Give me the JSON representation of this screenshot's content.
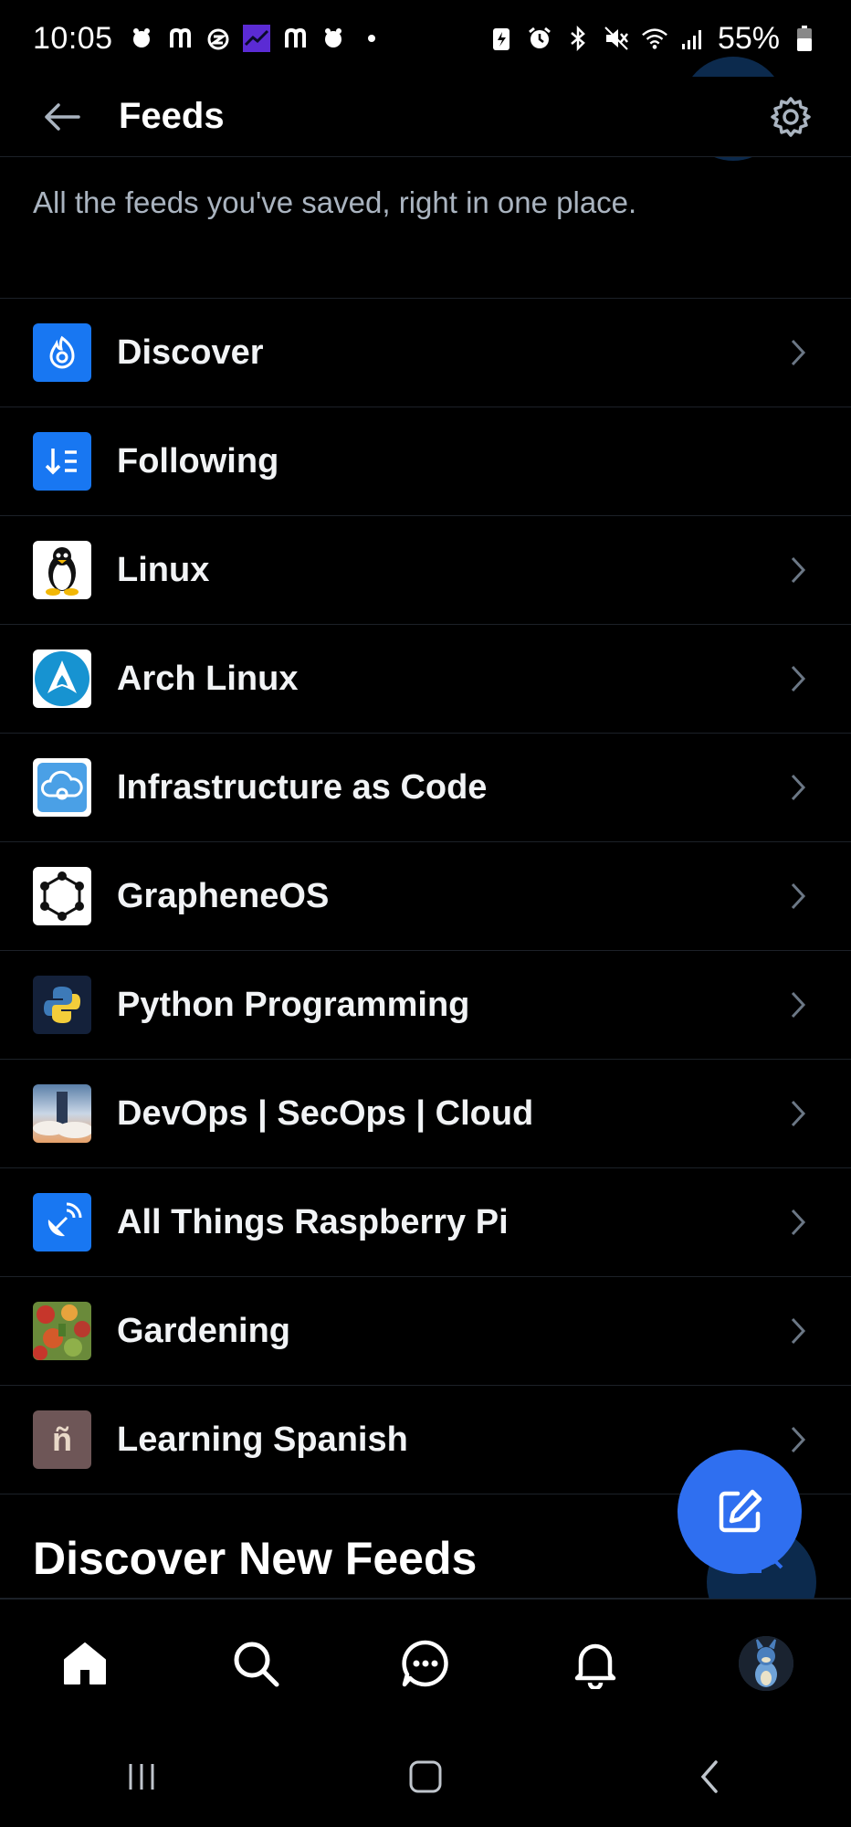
{
  "status_bar": {
    "time": "10:05",
    "battery": "55%",
    "left_icons": [
      "notification-icon",
      "n-app-icon",
      "dnd-icon",
      "stocks-app-icon",
      "n-app-icon",
      "notification-icon",
      "dot-icon"
    ],
    "right_icons": [
      "battery-saver-icon",
      "alarm-icon",
      "bluetooth-icon",
      "mute-icon",
      "wifi-icon",
      "signal-icon",
      "battery-icon"
    ]
  },
  "header": {
    "title": "Feeds",
    "back_icon": "arrow-left-icon",
    "settings_icon": "gear-icon"
  },
  "intro": {
    "description": "All the feeds you've saved, right in one place."
  },
  "feeds": [
    {
      "label": "Discover",
      "icon": "discover-feed-icon",
      "chevron": true
    },
    {
      "label": "Following",
      "icon": "following-feed-icon",
      "chevron": false
    },
    {
      "label": "Linux",
      "icon": "linux-penguin-icon",
      "chevron": true
    },
    {
      "label": "Arch Linux",
      "icon": "arch-linux-icon",
      "chevron": true
    },
    {
      "label": "Infrastructure as Code",
      "icon": "cloud-gear-icon",
      "chevron": true
    },
    {
      "label": "GrapheneOS",
      "icon": "graphene-hexagon-icon",
      "chevron": true
    },
    {
      "label": "Python Programming",
      "icon": "python-icon",
      "chevron": true
    },
    {
      "label": "DevOps | SecOps | Cloud",
      "icon": "cloud-photo-icon",
      "chevron": true
    },
    {
      "label": "All Things Raspberry Pi",
      "icon": "satellite-dish-icon",
      "chevron": true
    },
    {
      "label": "Gardening",
      "icon": "vegetables-photo-icon",
      "chevron": true
    },
    {
      "label": "Learning Spanish",
      "icon": "n-tilde-icon",
      "avatar_text": "ñ",
      "chevron": true
    }
  ],
  "discover": {
    "title": "Discover New Feeds"
  },
  "compose_icon": "compose-icon",
  "bottom_nav": [
    "home-icon",
    "search-icon",
    "chat-icon",
    "bell-icon",
    "profile-avatar"
  ],
  "system_nav": [
    "recents-icon",
    "home-square-icon",
    "back-chevron-icon"
  ],
  "colors": {
    "background": "#000000",
    "accent": "#2f6ff0",
    "muted_text": "#aab4c0",
    "divider": "#1c2128"
  }
}
